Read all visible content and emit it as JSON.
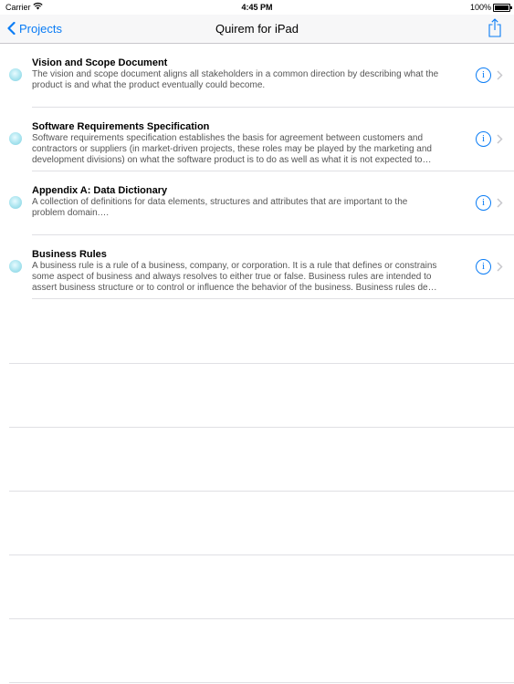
{
  "status_bar": {
    "carrier": "Carrier",
    "time": "4:45 PM",
    "battery": "100%"
  },
  "nav": {
    "back_label": "Projects",
    "title": "Quirem for iPad"
  },
  "documents": [
    {
      "title": "Vision and Scope Document",
      "description_lines": [
        "The vision and scope document aligns all stakeholders in a common direction by describing what the",
        "product is and what the product eventually could become."
      ]
    },
    {
      "title": "Software Requirements Specification",
      "description_lines": [
        "Software requirements specification establishes the basis for agreement between customers and",
        "contractors or suppliers (in market-driven projects, these roles may be played by the marketing and",
        "development divisions) on what the software product is to do as well as what it is not expected to…"
      ]
    },
    {
      "title": "Appendix A: Data Dictionary",
      "description_lines": [
        "A collection of definitions for data elements, structures and attributes that are important to the",
        "problem domain.…"
      ]
    },
    {
      "title": "Business Rules",
      "description_lines": [
        "A business rule is a rule of a business, company, or corporation. It is a rule that defines or constrains",
        "some aspect of business and always resolves to either true or false. Business rules are intended to",
        "assert business structure or to control or influence the behavior of the business. Business rules de…"
      ]
    }
  ],
  "colors": {
    "accent": "#0a7cf5",
    "separator": "#e0e0e4"
  },
  "icons": [
    "wifi-icon",
    "battery-icon",
    "back-chevron-icon",
    "share-icon",
    "status-dot-icon",
    "info-icon",
    "disclosure-chevron-icon"
  ]
}
